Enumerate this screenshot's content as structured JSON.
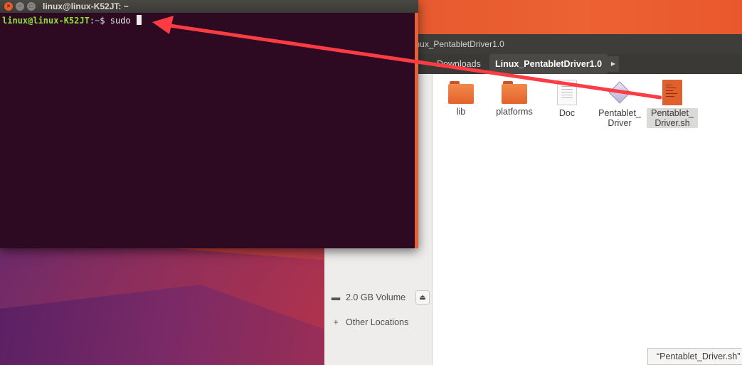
{
  "terminal": {
    "title": "linux@linux-K52JT: ~",
    "prompt_user": "linux@linux-K52JT",
    "prompt_sep": ":",
    "prompt_path": "~",
    "prompt_symbol": "$ ",
    "command": "sudo "
  },
  "files": {
    "window_title": "Linux_PentabletDriver1.0",
    "breadcrumbs": [
      "Downloads",
      "Linux_PentabletDriver1.0"
    ],
    "sidebar": {
      "volume": "2.0 GB Volume",
      "other_locations": "Other Locations"
    },
    "items": [
      {
        "name": "lib",
        "icon": "folder-icon"
      },
      {
        "name": "platforms",
        "icon": "folder-icon"
      },
      {
        "name": "Doc",
        "icon": "document-icon"
      },
      {
        "name": "Pentablet_ Driver",
        "icon": "executable-icon"
      },
      {
        "name": "Pentablet_ Driver.sh",
        "icon": "shell-script-icon"
      }
    ],
    "status": "“Pentablet_Driver.sh”"
  },
  "colors": {
    "annotation_arrow": "#ff3b44",
    "terminal_bg": "#300a24",
    "prompt_user": "#8ae234",
    "prompt_path": "#729fcf"
  }
}
